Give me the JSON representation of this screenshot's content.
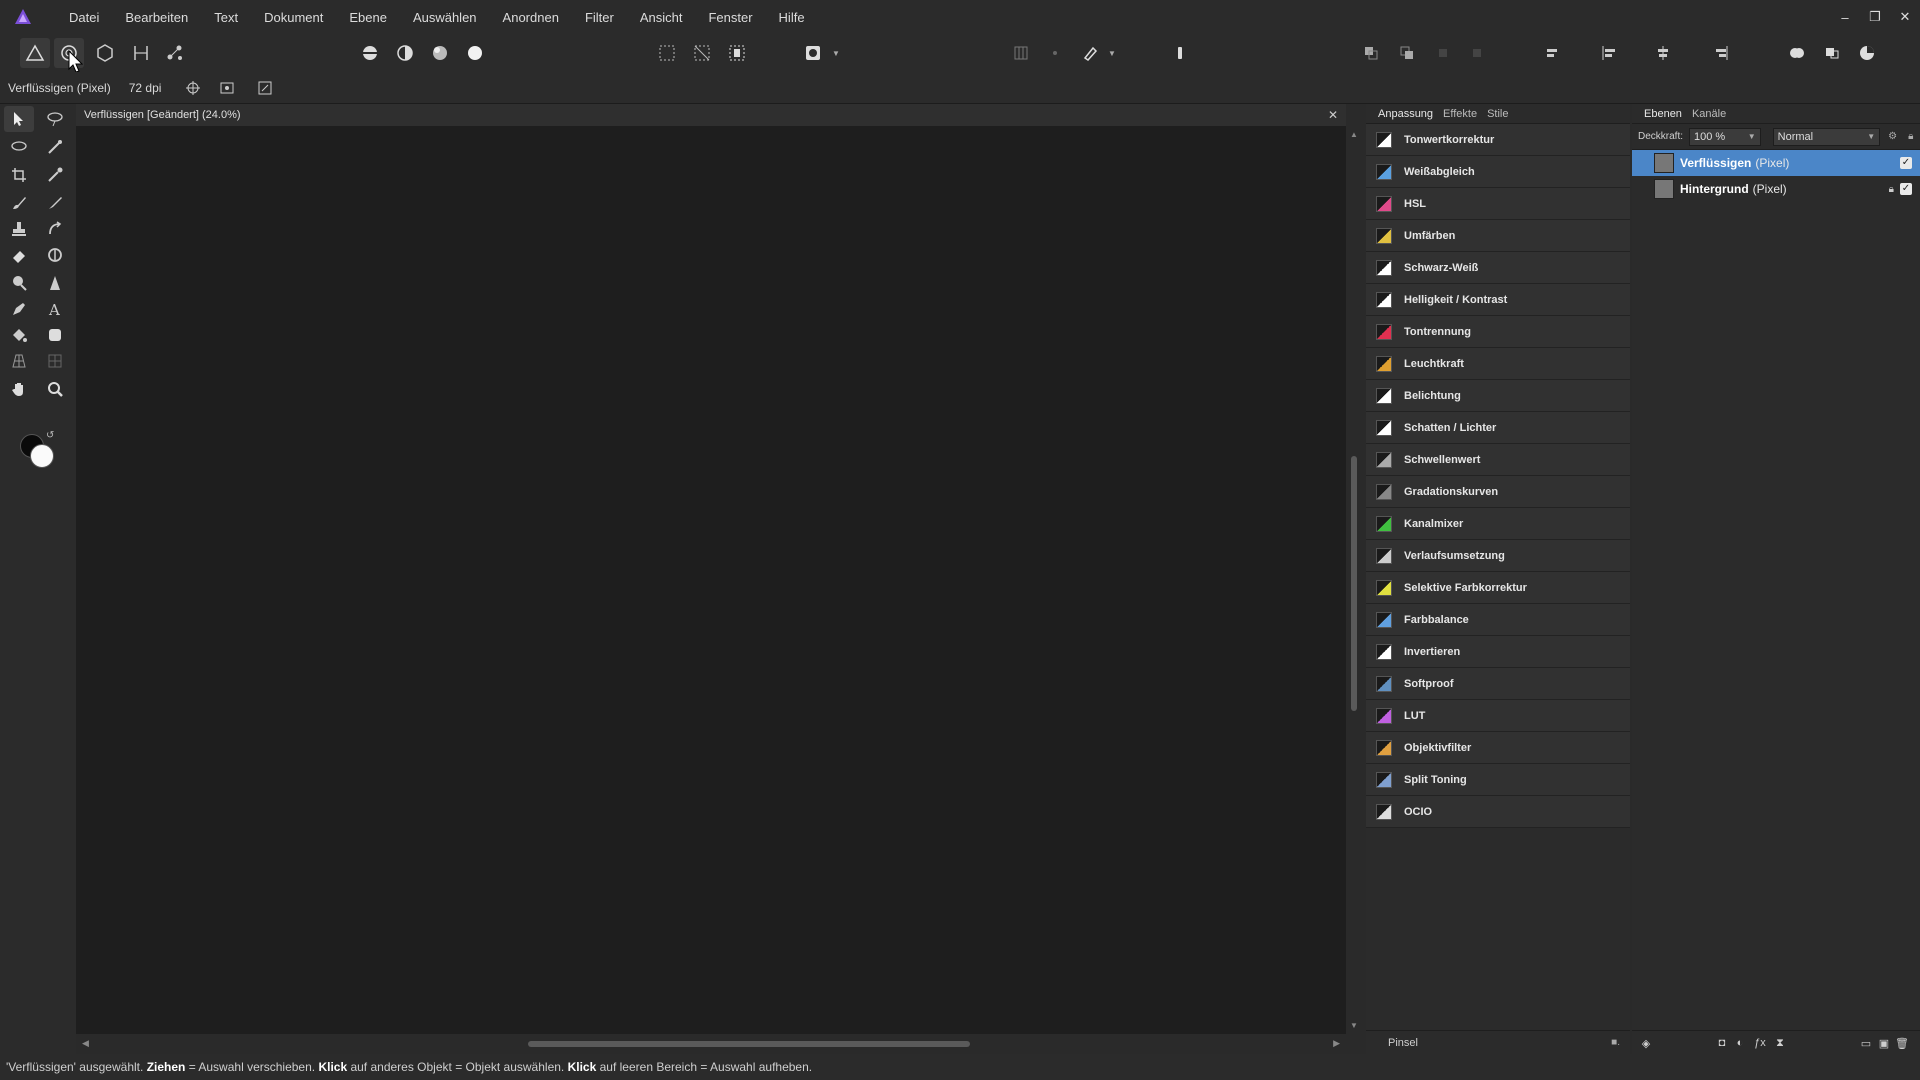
{
  "menubar": {
    "items": [
      "Datei",
      "Bearbeiten",
      "Text",
      "Dokument",
      "Ebene",
      "Auswählen",
      "Anordnen",
      "Filter",
      "Ansicht",
      "Fenster",
      "Hilfe"
    ]
  },
  "context": {
    "layer_label": "Verflüssigen (Pixel)",
    "dpi": "72 dpi"
  },
  "document": {
    "tab_title": "Verflüssigen [Geändert] (24.0%)"
  },
  "adjustments_panel": {
    "tabs": [
      "Anpassung",
      "Effekte",
      "Stile"
    ],
    "items": [
      {
        "label": "Tonwertkorrektur",
        "color": "#ffffff"
      },
      {
        "label": "Weißabgleich",
        "color": "#5aa0e0"
      },
      {
        "label": "HSL",
        "color": "#e04a8a"
      },
      {
        "label": "Umfärben",
        "color": "#e0c040"
      },
      {
        "label": "Schwarz-Weiß",
        "color": "#ffffff"
      },
      {
        "label": "Helligkeit / Kontrast",
        "color": "#ffffff"
      },
      {
        "label": "Tontrennung",
        "color": "#e03050"
      },
      {
        "label": "Leuchtkraft",
        "color": "#e0a030"
      },
      {
        "label": "Belichtung",
        "color": "#ffffff"
      },
      {
        "label": "Schatten / Lichter",
        "color": "#ffffff"
      },
      {
        "label": "Schwellenwert",
        "color": "#aaaaaa"
      },
      {
        "label": "Gradationskurven",
        "color": "#888888"
      },
      {
        "label": "Kanalmixer",
        "color": "#40c040"
      },
      {
        "label": "Verlaufsumsetzung",
        "color": "#cccccc"
      },
      {
        "label": "Selektive Farbkorrektur",
        "color": "#e0e040"
      },
      {
        "label": "Farbbalance",
        "color": "#60a0e0"
      },
      {
        "label": "Invertieren",
        "color": "#ffffff"
      },
      {
        "label": "Softproof",
        "color": "#6090c0"
      },
      {
        "label": "LUT",
        "color": "#c060e0"
      },
      {
        "label": "Objektivfilter",
        "color": "#e0a040"
      },
      {
        "label": "Split Toning",
        "color": "#80a0d0"
      },
      {
        "label": "OCIO",
        "color": "#dddddd"
      }
    ],
    "footer_label": "Pinsel"
  },
  "layers_panel": {
    "tabs": [
      "Ebenen",
      "Kanäle"
    ],
    "opacity_label": "Deckkraft:",
    "opacity_value": "100 %",
    "blend_mode": "Normal",
    "layers": [
      {
        "name": "Verflüssigen",
        "type": "(Pixel)",
        "selected": true
      },
      {
        "name": "Hintergrund",
        "type": "(Pixel)",
        "selected": false
      }
    ]
  },
  "statusbar": {
    "part1": "'Verflüssigen' ausgewählt. ",
    "b1": "Ziehen",
    "part2": " = Auswahl verschieben. ",
    "b2": "Klick",
    "part3": " auf anderes Objekt = Objekt auswählen. ",
    "b3": "Klick",
    "part4": " auf leeren Bereich = Auswahl aufheben."
  },
  "colors": {
    "accent": "#4b86c8",
    "app_logo": "#7b4fd8"
  }
}
